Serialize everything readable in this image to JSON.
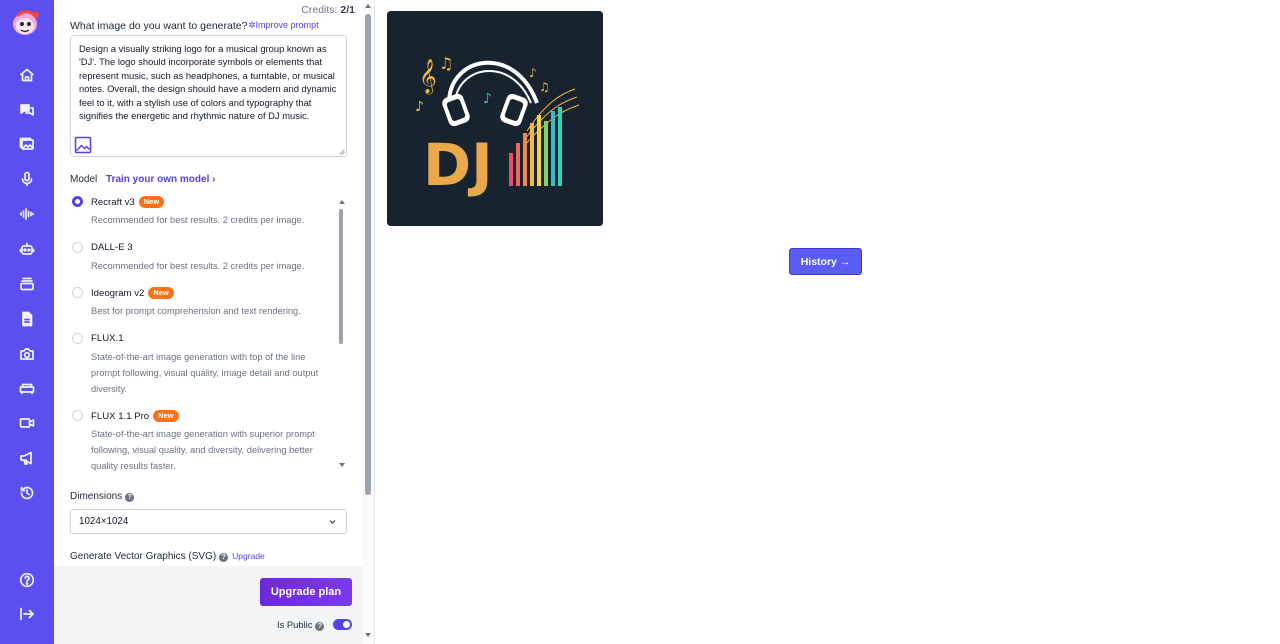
{
  "sidebar": {
    "logo_icon": "mascot-logo",
    "items": [
      {
        "name": "home",
        "icon": "home-icon"
      },
      {
        "name": "chat",
        "icon": "chat-icon"
      },
      {
        "name": "images",
        "icon": "images-icon"
      },
      {
        "name": "voice",
        "icon": "microphone-icon"
      },
      {
        "name": "audio",
        "icon": "waveform-icon"
      },
      {
        "name": "bots",
        "icon": "robot-icon"
      },
      {
        "name": "storage",
        "icon": "archive-icon"
      },
      {
        "name": "documents",
        "icon": "document-icon"
      },
      {
        "name": "photo",
        "icon": "camera-icon"
      },
      {
        "name": "interior",
        "icon": "sofa-icon"
      },
      {
        "name": "video",
        "icon": "video-icon"
      },
      {
        "name": "marketing",
        "icon": "megaphone-icon"
      },
      {
        "name": "history",
        "icon": "history-icon"
      },
      {
        "name": "help",
        "icon": "help-icon"
      },
      {
        "name": "logout",
        "icon": "logout-icon"
      }
    ]
  },
  "panel": {
    "credits_label": "Credits:",
    "credits_value": "2/1",
    "prompt_label": "What image do you want to generate?",
    "improve_label": "Improve prompt",
    "prompt_text": "Design a visually striking logo for a musical group known as 'DJ'. The logo should incorporate symbols or elements that represent music, such as headphones, a turntable, or musical notes. Overall, the design should have a modern and dynamic feel to it, with a stylish use of colors and typography that signifies the energetic and rhythmic nature of DJ music.",
    "model_label": "Model",
    "train_label": "Train your own model",
    "models": [
      {
        "name": "Recraft v3",
        "badge": "New",
        "desc": "Recommended for best results. 2 credits per image.",
        "selected": true
      },
      {
        "name": "DALL-E 3",
        "badge": "",
        "desc": "Recommended for best results. 2 credits per image.",
        "selected": false
      },
      {
        "name": "Ideogram v2",
        "badge": "New",
        "desc": "Best for prompt comprehension and text rendering.",
        "selected": false
      },
      {
        "name": "FLUX.1",
        "badge": "",
        "desc": "State-of-the-art image generation with top of the line prompt following, visual quality, image detail and output diversity.",
        "selected": false
      },
      {
        "name": "FLUX 1.1 Pro",
        "badge": "New",
        "desc": "State-of-the-art image generation with superior prompt following, visual quality, and diversity, delivering better quality results faster.",
        "selected": false
      }
    ],
    "dimensions_label": "Dimensions",
    "dimensions_value": "1024×1024",
    "svg_label": "Generate Vector Graphics (SVG)",
    "svg_upgrade": "Upgrade",
    "upgrade_button": "Upgrade plan",
    "public_label": "Is Public",
    "public_on": true
  },
  "main": {
    "image_text": "DJ",
    "history_button": "History →"
  },
  "colors": {
    "sidebar": "#5b4ff0",
    "accent": "#4f46e5",
    "badge": "#f97316",
    "upgrade": "#7c3aed"
  }
}
